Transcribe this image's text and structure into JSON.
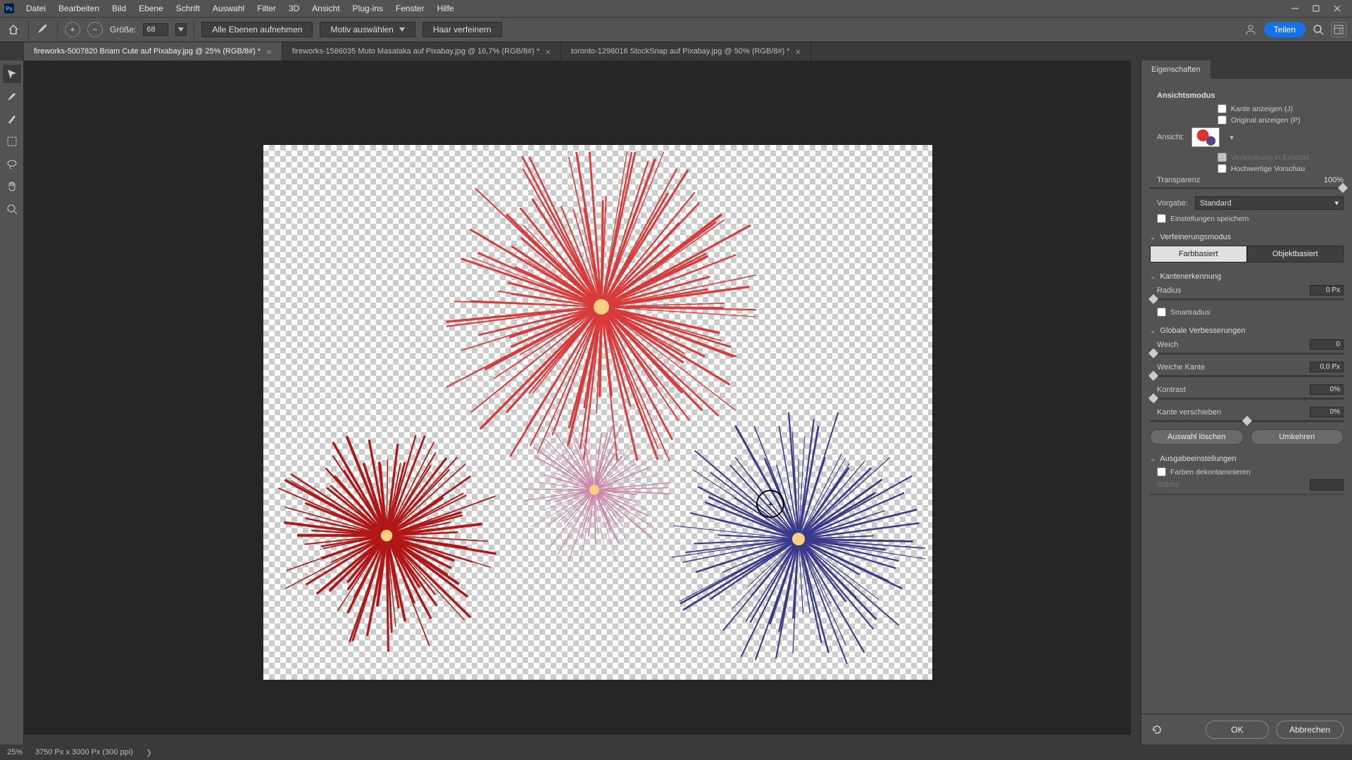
{
  "menu": {
    "items": [
      "Datei",
      "Bearbeiten",
      "Bild",
      "Ebene",
      "Schrift",
      "Auswahl",
      "Filter",
      "3D",
      "Ansicht",
      "Plug-ins",
      "Fenster",
      "Hilfe"
    ]
  },
  "options": {
    "size_label": "Größe:",
    "size_value": "68",
    "sample_all": "Alle Ebenen aufnehmen",
    "select_subject": "Motiv auswählen",
    "refine_hair": "Haar verfeinern",
    "share": "Teilen"
  },
  "tabs": [
    {
      "label": "fireworks-5007820 Briam Cute auf Pixabay.jpg @ 25% (RGB/8#) *",
      "active": true
    },
    {
      "label": "fireworks-1586035 Muto Masataka auf Pixabay.jpg @ 16,7% (RGB/8#) *",
      "active": false
    },
    {
      "label": "toronto-1298016 StockSnap auf Pixabay.jpg @ 50% (RGB/8#) *",
      "active": false
    }
  ],
  "panel": {
    "title": "Eigenschaften",
    "view_mode_header": "Ansichtsmodus",
    "view_label": "Ansicht:",
    "show_edge": "Kante anzeigen (J)",
    "show_original": "Original anzeigen (P)",
    "realtime": "Verfeinerung in Echtzeit",
    "hq_preview": "Hochwertige Vorschau",
    "transparency_label": "Transparenz",
    "transparency_value": "100%",
    "preset_label": "Vorgabe:",
    "preset_value": "Standard",
    "remember_settings": "Einstellungen speichern",
    "refine_mode_header": "Verfeinerungsmodus",
    "mode_color": "Farbbasiert",
    "mode_object": "Objektbasiert",
    "edge_detect_header": "Kantenerkennung",
    "radius_label": "Radius",
    "radius_value": "0 Px",
    "smart_radius": "Smartradius",
    "global_header": "Globale Verbesserungen",
    "smooth_label": "Weich",
    "smooth_value": "0",
    "feather_label": "Weiche Kante",
    "feather_value": "0,0 Px",
    "contrast_label": "Kontrast",
    "contrast_value": "0%",
    "shift_label": "Kante verschieben",
    "shift_value": "0%",
    "clear_sel": "Auswahl löschen",
    "invert": "Umkehren",
    "output_header": "Ausgabeeinstellungen",
    "decontaminate": "Farben dekontaminieren",
    "strength_label": "Stärke",
    "ok": "OK",
    "cancel": "Abbrechen"
  },
  "status": {
    "zoom": "25%",
    "doc_info": "3750 Px x 3000 Px (300 ppi)"
  }
}
